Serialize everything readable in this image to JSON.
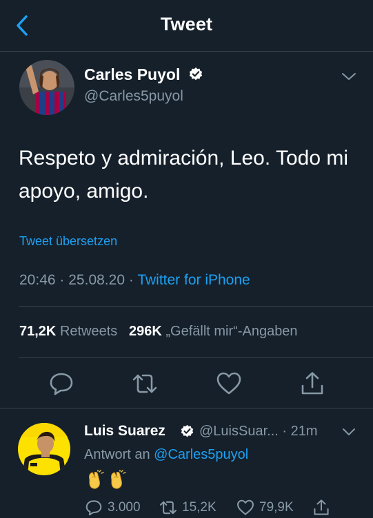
{
  "header": {
    "title": "Tweet"
  },
  "tweet": {
    "author_name": "Carles Puyol",
    "author_handle": "@Carles5puyol",
    "text": "Respeto y admiración, Leo. Todo mi apoyo, amigo.",
    "translate_link": "Tweet übersetzen",
    "time": "20:46",
    "date": "25.08.20",
    "dot": "·",
    "source": "Twitter for iPhone",
    "retweets_count": "71,2K",
    "retweets_label": "Retweets",
    "likes_count": "296K",
    "likes_label": "„Gefällt mir“-Angaben"
  },
  "reply": {
    "author_name": "Luis Suarez",
    "author_handle": "@LuisSuar...",
    "time": "· 21m",
    "reply_prefix": "Antwort an",
    "reply_mention": "@Carles5puyol",
    "emoji": [
      "clapping-hands",
      "clapping-hands"
    ],
    "replies_count": "3.000",
    "retweets_count": "15,2K",
    "likes_count": "79,9K"
  },
  "colors": {
    "background": "#15202b",
    "divider": "#38444d",
    "accent": "#1da1f2",
    "secondary_text": "#8899a6",
    "jersey_barca": "#a50044",
    "jersey_bvb": "#fde100"
  },
  "icons": {
    "back": "chevron-left-icon",
    "verified": "verified-badge-icon",
    "caret": "chevron-down-icon",
    "reply": "reply-icon",
    "retweet": "retweet-icon",
    "like": "heart-icon",
    "share": "share-icon"
  }
}
